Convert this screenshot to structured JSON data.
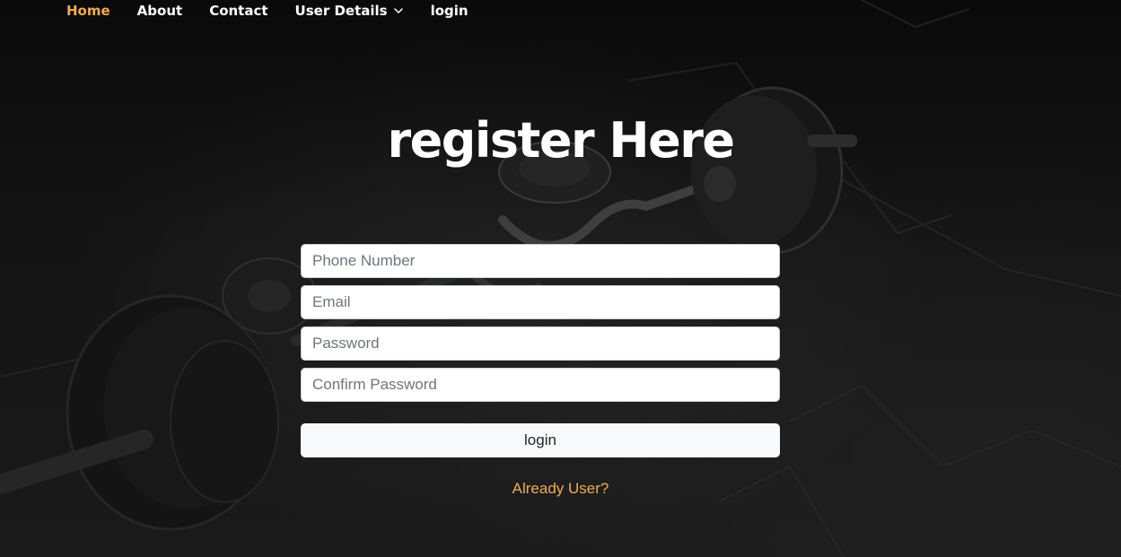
{
  "nav": {
    "items": [
      {
        "label": "Home",
        "active": true
      },
      {
        "label": "About"
      },
      {
        "label": "Contact"
      },
      {
        "label": "User Details",
        "icon": "chevron-down-icon"
      },
      {
        "label": "login"
      }
    ]
  },
  "page": {
    "title": "register Here"
  },
  "form": {
    "phone_placeholder": "Phone Number",
    "email_placeholder": "Email",
    "password_placeholder": "Password",
    "confirm_placeholder": "Confirm Password",
    "submit_label": "login",
    "already_user_link": "Already User?"
  },
  "colors": {
    "accent": "#f0ad4e",
    "background": "#111111",
    "text": "#ffffff"
  }
}
